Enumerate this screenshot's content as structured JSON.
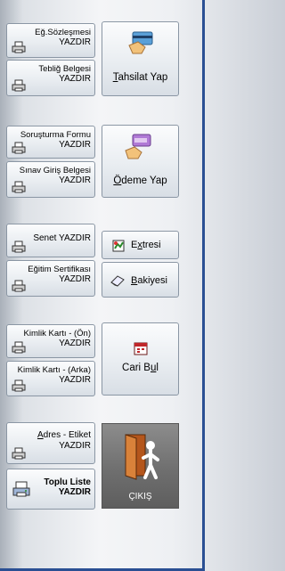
{
  "buttons": {
    "eg_sozlesmesi": {
      "line1": "Eğ.Sözleşmesi",
      "line2": "YAZDIR"
    },
    "teblig_belgesi": {
      "line1": "Tebliğ Belgesi",
      "line2": "YAZDIR"
    },
    "tahsilat_yap": {
      "prefix": "T",
      "rest": "ahsilat Yap"
    },
    "sorusturma_formu": {
      "line1": "Soruşturma Formu",
      "line2": "YAZDIR"
    },
    "sinav_giris": {
      "line1": "Sınav Giriş Belgesi",
      "line2": "YAZDIR"
    },
    "odeme_yap": {
      "prefix": "Ö",
      "rest": "deme Yap"
    },
    "senet": {
      "line1": "Senet YAZDIR"
    },
    "egitim_sertifikasi": {
      "line1": "Eğitim Sertifikası",
      "line2": "YAZDIR"
    },
    "extresi": {
      "pre": "E",
      "u": "x",
      "rest": "tresi"
    },
    "bakiyesi": {
      "u": "B",
      "rest": "akiyesi"
    },
    "kimlik_on": {
      "line1": "Kimlik Kartı - (Ön)",
      "line2": "YAZDIR"
    },
    "kimlik_arka": {
      "line1": "Kimlik Kartı - (Arka)",
      "line2": "YAZDIR"
    },
    "cari_bul": {
      "pre": "Cari B",
      "u": "u",
      "rest": "l"
    },
    "adres_etiket": {
      "pre": "",
      "u": "A",
      "rest": "dres - Etiket",
      "line2": "YAZDIR"
    },
    "toplu_liste": {
      "line1": "Toplu Liste",
      "line2": "YAZDIR"
    },
    "cikis": {
      "label": "ÇIKIŞ"
    }
  },
  "icons": {
    "printer": "printer-icon",
    "tahsilat": "card-payment-icon",
    "odeme": "card-payment-icon",
    "extre": "statement-icon",
    "bakiye": "eraser-icon",
    "cari": "calendar-icon",
    "exit": "exit-door-icon",
    "toplu": "printer-list-icon"
  },
  "colors": {
    "border": "#2a4f93",
    "exit_bg": "#6f6f6f"
  }
}
